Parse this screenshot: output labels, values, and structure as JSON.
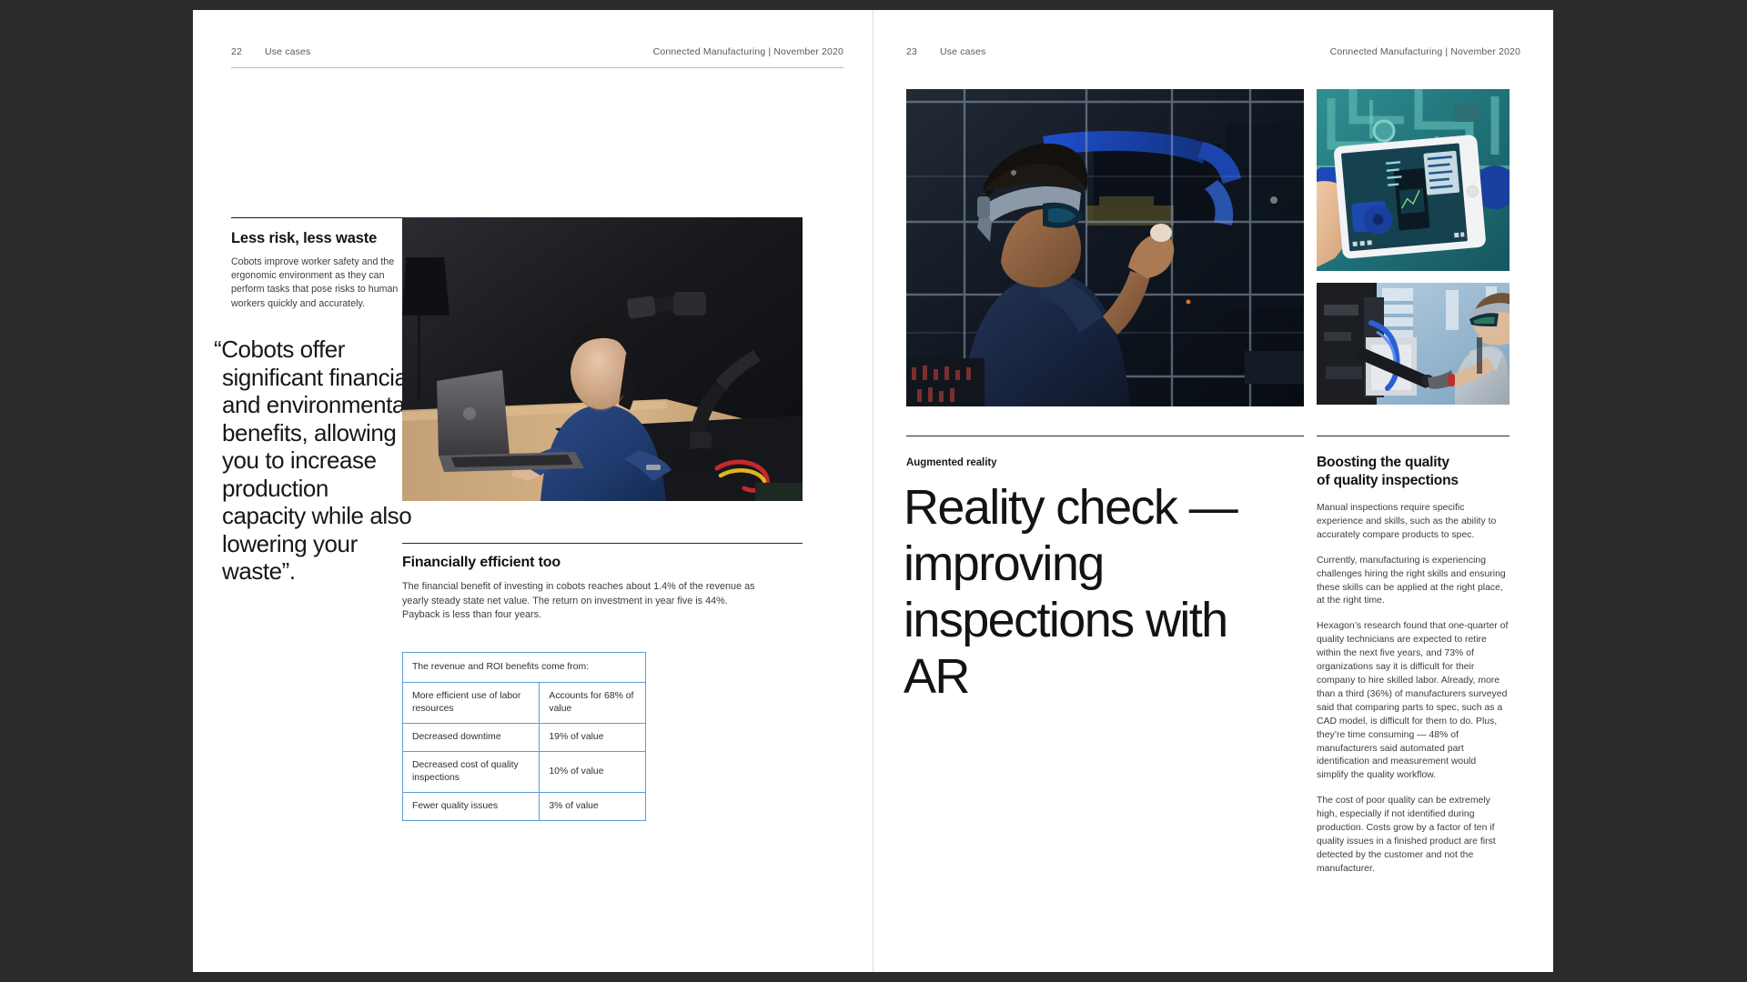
{
  "document": {
    "publication": "Connected Manufacturing",
    "separator": "|",
    "issue_date": "November 2020",
    "section": "Use cases"
  },
  "left_page": {
    "folio": "22",
    "section": "Use cases",
    "publication_line": "Connected Manufacturing  |  November 2020",
    "subhead": "Less risk, less waste",
    "intro": "Cobots improve worker safety and the ergonomic environment as they can perform tasks that pose risks to human workers quickly and accurately.",
    "pullquote": "“Cobots offer significant financial and environmental benefits, allowing you to increase production capacity while also lowering your waste”.",
    "photo_caption": "woman-at-laptop-with-robotic-arm",
    "finance": {
      "heading": "Financially efficient too",
      "body": "The financial benefit of investing in cobots reaches about 1.4% of the revenue as yearly steady state net value. The return on investment in year five is 44%. Payback is less than four years."
    },
    "table": {
      "border_color": "#5d9cd8",
      "header": "The revenue and ROI benefits come from:",
      "rows": [
        {
          "label": "More efficient use of labor resources",
          "value": "Accounts for 68% of value"
        },
        {
          "label": "Decreased downtime",
          "value": "19% of value"
        },
        {
          "label": "Decreased cost of quality inspections",
          "value": "10% of value"
        },
        {
          "label": "Fewer quality issues",
          "value": "3% of value"
        }
      ]
    }
  },
  "right_page": {
    "folio": "23",
    "section": "Use cases",
    "publication_line": "Connected Manufacturing  |  November 2020",
    "kicker": "Augmented reality",
    "display_title": "Reality check — improving inspections with AR",
    "photos": [
      {
        "name": "ar-headset-worker-factory"
      },
      {
        "name": "tablet-ar-overlay-machinery"
      },
      {
        "name": "technician-ar-headset-assembly"
      }
    ],
    "column": {
      "heading_line_1": "Boosting the quality",
      "heading_line_2": "of quality inspections",
      "paragraphs": [
        "Manual inspections require specific experience and skills, such as the ability to accurately compare products to spec.",
        "Currently, manufacturing is experiencing challenges hiring the right skills and ensuring these skills can be applied at the right place, at the right time.",
        "Hexagon’s research found that one-quarter of quality technicians are expected to retire within the next five years, and 73% of organizations say it is difficult for their company to hire skilled labor. Already, more than a third (36%) of manufacturers surveyed said that comparing parts to spec, such as a CAD model, is difficult for them to do. Plus, they’re time consuming — 48% of manufacturers said automated part identification and measurement would simplify the quality workflow.",
        "The cost of poor quality can be extremely high, especially if not identified during production. Costs grow by a factor of ten if quality issues in a finished product are first detected by the customer and not the manufacturer."
      ]
    }
  },
  "colors": {
    "page_background": "#ffffff",
    "canvas_background": "#2b2b2b",
    "table_border": "#5d9cd8",
    "body_text": "#3b3c3e",
    "heading_text": "#121315",
    "rule": "#bcbcbc"
  }
}
